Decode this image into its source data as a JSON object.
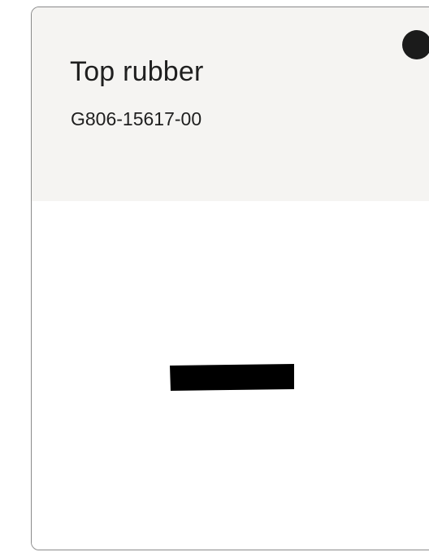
{
  "card": {
    "title": "Top rubber",
    "part_number": "G806-15617-00",
    "status_dot_color": "#1b1b1b",
    "image_icon": "rubber-strip-icon"
  }
}
